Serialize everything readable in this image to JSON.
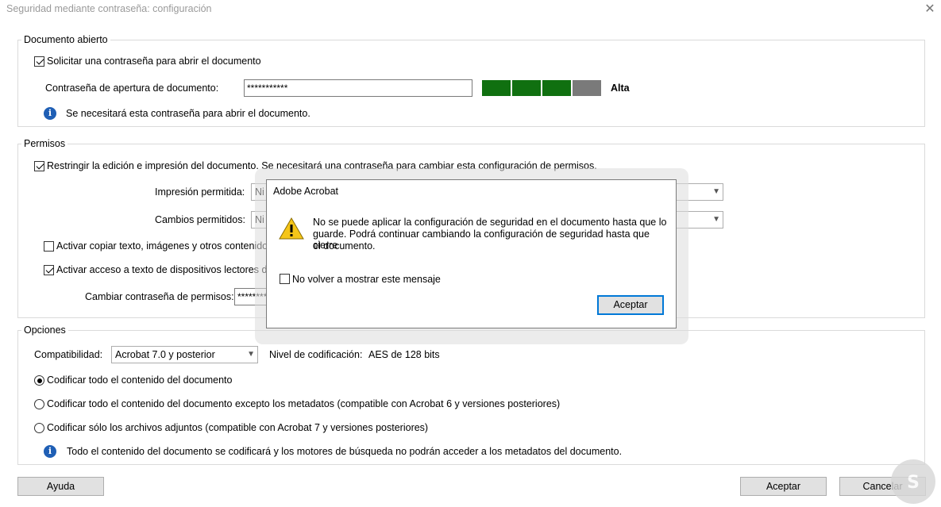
{
  "window": {
    "title": "Seguridad mediante contraseña: configuración",
    "close_glyph": "✕"
  },
  "open_doc": {
    "legend": "Documento abierto",
    "require_label": "Solicitar una contraseña para abrir el documento",
    "require_checked": true,
    "password_label": "Contraseña de apertura de documento:",
    "password_value": "***********",
    "strength_label": "Alta",
    "strength_level": 3,
    "strength_max": 4,
    "info_text": "Se necesitará esta contraseña para abrir el documento."
  },
  "permissions": {
    "legend": "Permisos",
    "restrict_label": "Restringir la edición e impresión del documento. Se necesitará una contraseña para cambiar esta configuración de permisos.",
    "restrict_checked": true,
    "print_label": "Impresión permitida:",
    "print_value": "Ni",
    "changes_label": "Cambios permitidos:",
    "changes_value": "Ni",
    "copy_label": "Activar copiar texto, imágenes y otros contenidos",
    "copy_checked": false,
    "access_label": "Activar acceso a texto de dispositivos lectores de p",
    "access_checked": true,
    "change_pw_label": "Cambiar contraseña de permisos:",
    "change_pw_value": "********"
  },
  "options": {
    "legend": "Opciones",
    "compat_label": "Compatibilidad:",
    "compat_value": "Acrobat 7.0 y posterior",
    "encryption_label": "Nivel de codificación:",
    "encryption_value": "AES de 128 bits",
    "radio_all": "Codificar todo el contenido del documento",
    "radio_except_meta": "Codificar todo el contenido del documento excepto los metadatos (compatible con Acrobat 6 y versiones posteriores)",
    "radio_attachments": "Codificar sólo los archivos adjuntos (compatible con Acrobat 7 y versiones posteriores)",
    "selected_radio": "all",
    "info_text": "Todo el contenido del documento se codificará y los motores de búsqueda no podrán acceder a los metadatos del documento."
  },
  "footer": {
    "help": "Ayuda",
    "ok": "Aceptar",
    "cancel": "Cancelar"
  },
  "dialog": {
    "title": "Adobe Acrobat",
    "message_line1": "No se puede aplicar la configuración de seguridad en el documento hasta que lo",
    "message_line2": "guarde. Podrá continuar cambiando la configuración de seguridad hasta que cierre",
    "message_line3": "el documento.",
    "dont_show_label": "No volver a mostrar este mensaje",
    "dont_show_checked": false,
    "ok": "Aceptar"
  },
  "colors": {
    "strength_on": "#107010",
    "strength_off": "#7a7a7a",
    "info_blue": "#1f5fb5",
    "focus_blue": "#0078d7",
    "warn_yellow": "#f5c518"
  }
}
